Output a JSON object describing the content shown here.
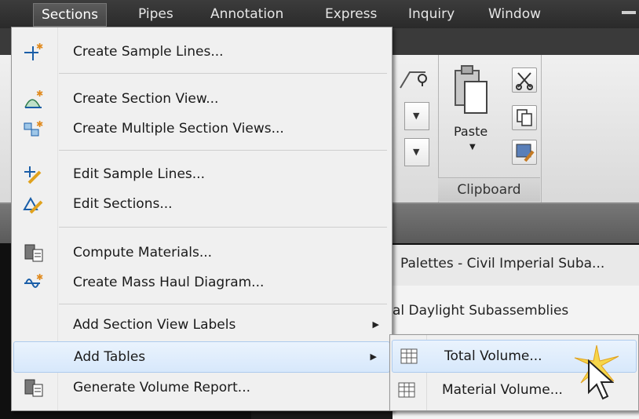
{
  "menubar": {
    "items": [
      "Sections",
      "Pipes",
      "Annotation",
      "Express",
      "Inquiry",
      "Window"
    ],
    "active": "Sections"
  },
  "sections_menu": {
    "items": [
      {
        "label": "Create Sample Lines...",
        "icon": "sample-lines-icon"
      },
      {
        "label": "Create Section View...",
        "icon": "section-view-icon"
      },
      {
        "label": "Create Multiple Section Views...",
        "icon": "multiple-section-views-icon"
      },
      {
        "label": "Edit Sample Lines...",
        "icon": "edit-sample-lines-icon"
      },
      {
        "label": "Edit Sections...",
        "icon": "edit-sections-icon"
      },
      {
        "label": "Compute Materials...",
        "icon": "compute-materials-icon"
      },
      {
        "label": "Create Mass Haul Diagram...",
        "icon": "mass-haul-icon"
      },
      {
        "label": "Add Section View Labels",
        "has_submenu": true
      },
      {
        "label": "Add Tables",
        "has_submenu": true,
        "highlighted": true
      },
      {
        "label": "Generate Volume Report...",
        "icon": "volume-report-icon"
      }
    ]
  },
  "add_tables_submenu": {
    "items": [
      {
        "label": "Total Volume...",
        "icon": "table-icon",
        "highlighted": true
      },
      {
        "label": "Material Volume...",
        "icon": "table-icon"
      }
    ]
  },
  "ribbon": {
    "paste_label": "Paste",
    "clipboard_group_label": "Clipboard"
  },
  "tool_palette": {
    "title": "Palettes - Civil Imperial Suba...",
    "item": "al Daylight Subassemblies"
  },
  "colors": {
    "highlight_bg": "#d7e8fb",
    "highlight_border": "#aecbee",
    "menu_bg": "#f0f0f0",
    "menubar_bg": "#2f2f2f"
  }
}
